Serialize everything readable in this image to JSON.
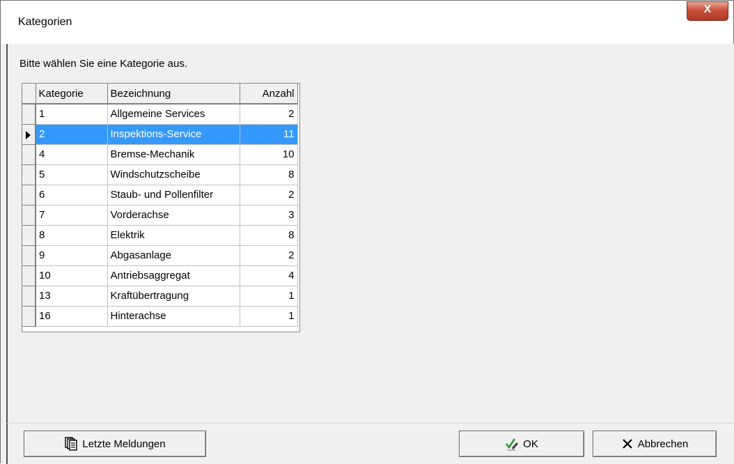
{
  "window": {
    "title": "Kategorien",
    "close_label": "X"
  },
  "prompt": "Bitte wählen Sie eine Kategorie aus.",
  "grid": {
    "headers": {
      "kategorie": "Kategorie",
      "bezeichnung": "Bezeichnung",
      "anzahl": "Anzahl"
    },
    "selected_index": 1,
    "rows": [
      {
        "kategorie": "1",
        "bezeichnung": "Allgemeine Services",
        "anzahl": "2"
      },
      {
        "kategorie": "2",
        "bezeichnung": "Inspektions-Service",
        "anzahl": "11"
      },
      {
        "kategorie": "4",
        "bezeichnung": "Bremse-Mechanik",
        "anzahl": "10"
      },
      {
        "kategorie": "5",
        "bezeichnung": "Windschutzscheibe",
        "anzahl": "8"
      },
      {
        "kategorie": "6",
        "bezeichnung": "Staub- und Pollenfilter",
        "anzahl": "2"
      },
      {
        "kategorie": "7",
        "bezeichnung": "Vorderachse",
        "anzahl": "3"
      },
      {
        "kategorie": "8",
        "bezeichnung": "Elektrik",
        "anzahl": "8"
      },
      {
        "kategorie": "9",
        "bezeichnung": "Abgasanlage",
        "anzahl": "2"
      },
      {
        "kategorie": "10",
        "bezeichnung": "Antriebsaggregat",
        "anzahl": "4"
      },
      {
        "kategorie": "13",
        "bezeichnung": "Kraftübertragung",
        "anzahl": "1"
      },
      {
        "kategorie": "16",
        "bezeichnung": "Hinterachse",
        "anzahl": "1"
      }
    ]
  },
  "buttons": {
    "letzte": {
      "label": "Letzte Meldungen",
      "icon": "documents-icon"
    },
    "ok": {
      "label": "OK",
      "icon": "checkmark-pen-icon"
    },
    "abbrechen": {
      "label": "Abbrechen",
      "icon": "cross-icon"
    }
  },
  "colors": {
    "selection": "#3399ff",
    "close_button": "#c7503a"
  }
}
